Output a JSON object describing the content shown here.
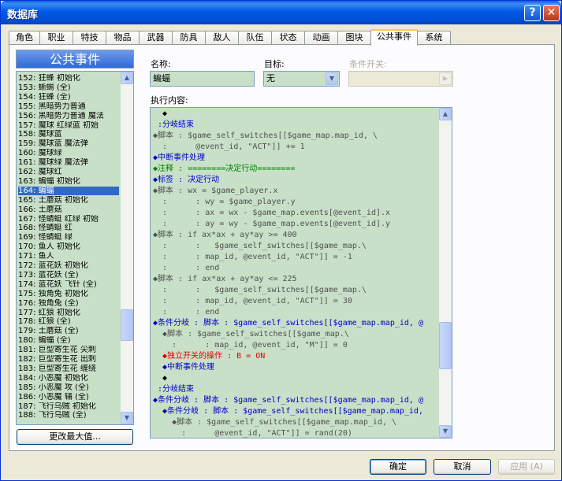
{
  "window": {
    "title": "数据库"
  },
  "tabs": [
    "角色",
    "职业",
    "特技",
    "物品",
    "武器",
    "防具",
    "敌人",
    "队伍",
    "状态",
    "动画",
    "图块",
    "公共事件",
    "系统"
  ],
  "active_tab": 11,
  "list": {
    "header": "公共事件",
    "items": [
      "152: 狂蜂 初始化",
      "153: 蜥蜴 (全)",
      "154: 狂蜂 (全)",
      "155: 黑暗势力普通",
      "156: 黑暗势力普通 魔法",
      "157: 魔球 红绿蓝 初始",
      "158: 魔球蓝",
      "159: 魔球蓝 魔法弹",
      "160: 魔球绿",
      "161: 魔球绿 魔法弹",
      "162: 魔球红",
      "163: 蝙蝠 初始化",
      "164: 蝙蝠",
      "165: 土蘑菇 初始化",
      "166: 土蘑菇",
      "167: 怪蜻蜓 红绿 初始",
      "168: 怪蜻蜓 红",
      "169: 怪蜻蜓 绿",
      "170: 鱼人 初始化",
      "171: 鱼人",
      "172: 蓝花妖 初始化",
      "173: 蓝花妖 (全)",
      "174: 蓝花妖 飞针 (全)",
      "175: 独角兔 初始化",
      "176: 独角兔 (全)",
      "177: 红狼 初始化",
      "178: 红狼 (全)",
      "179: 土蘑菇 (全)",
      "180: 蝙蝠 (全)",
      "181: 巨型寄生花 尖刺",
      "182: 巨型寄生花 出刺",
      "183: 巨型寄生花 缠绕",
      "184: 小恶魔 初始化",
      "185: 小恶魔 攻 (全)",
      "186: 小恶魔 辅 (全)",
      "187: 飞行乌贼 初始化",
      "188: 飞行乌贼 (全)"
    ],
    "selected_index": 12,
    "change_max_button": "更改最大值..."
  },
  "form": {
    "name_label": "名称:",
    "name_value": "蝙蝠",
    "target_label": "目标:",
    "target_value": "无",
    "switch_label": "条件开关:",
    "switch_value": "",
    "content_label": "执行内容:"
  },
  "code_lines": [
    {
      "t": "  ◆",
      "c": "dark"
    },
    {
      "t": " :分岐结束",
      "c": "blue"
    },
    {
      "t": "◆脚本 : $game_self_switches[[$game_map.map_id, \\",
      "c": "gray"
    },
    {
      "t": "  :      @event_id, \"ACT\"]] += 1",
      "c": "gray"
    },
    {
      "t": "◆中断事件处理",
      "c": "blue"
    },
    {
      "t": "◆注释 : ========决定行动========",
      "c": "green"
    },
    {
      "t": "◆标签 : 决定行动",
      "c": "blue"
    },
    {
      "t": "◆脚本 : wx = $game_player.x",
      "c": "gray"
    },
    {
      "t": "  :      : wy = $game_player.y",
      "c": "gray"
    },
    {
      "t": "  :      : ax = wx - $game_map.events[@event_id].x",
      "c": "gray"
    },
    {
      "t": "  :      : ay = wy - $game_map.events[@event_id].y",
      "c": "gray"
    },
    {
      "t": "◆脚本 : if ax*ax + ay*ay >= 400",
      "c": "gray"
    },
    {
      "t": "  :      :   $game_self_switches[[$game_map.\\",
      "c": "gray"
    },
    {
      "t": "  :      : map_id, @event_id, \"ACT\"]] = -1",
      "c": "gray"
    },
    {
      "t": "  :      : end",
      "c": "gray"
    },
    {
      "t": "◆脚本 : if ax*ax + ay*ay <= 225",
      "c": "gray"
    },
    {
      "t": "  :      :   $game_self_switches[[$game_map.\\",
      "c": "gray"
    },
    {
      "t": "  :      : map_id, @event_id, \"ACT\"]] = 30",
      "c": "gray"
    },
    {
      "t": "  :      : end",
      "c": "gray"
    },
    {
      "t": "◆条件分岐 : 脚本 : $game_self_switches[[$game_map.map_id, @",
      "c": "blue"
    },
    {
      "t": "  ◆脚本 : $game_self_switches[[$game_map.\\",
      "c": "gray"
    },
    {
      "t": "    :      : map_id, @event_id, \"M\"]] = 0",
      "c": "gray"
    },
    {
      "t": "  ◆独立开关的操作 : B = ON",
      "c": "red"
    },
    {
      "t": "  ◆中断事件处理",
      "c": "blue"
    },
    {
      "t": "  ◆",
      "c": "dark"
    },
    {
      "t": " :分岐结束",
      "c": "blue"
    },
    {
      "t": "◆条件分岐 : 脚本 : $game_self_switches[[$game_map.map_id, @",
      "c": "blue"
    },
    {
      "t": "  ◆条件分岐 : 脚本 : $game_self_switches[[$game_map.map_id,",
      "c": "blue"
    },
    {
      "t": "    ◆脚本 : $game_self_switches[[$game_map.map_id, \\",
      "c": "gray"
    },
    {
      "t": "      :      @event_id, \"ACT\"]] = rand(20)",
      "c": "gray"
    }
  ],
  "buttons": {
    "ok": "确定",
    "cancel": "取消",
    "apply": "应用 (A)"
  }
}
